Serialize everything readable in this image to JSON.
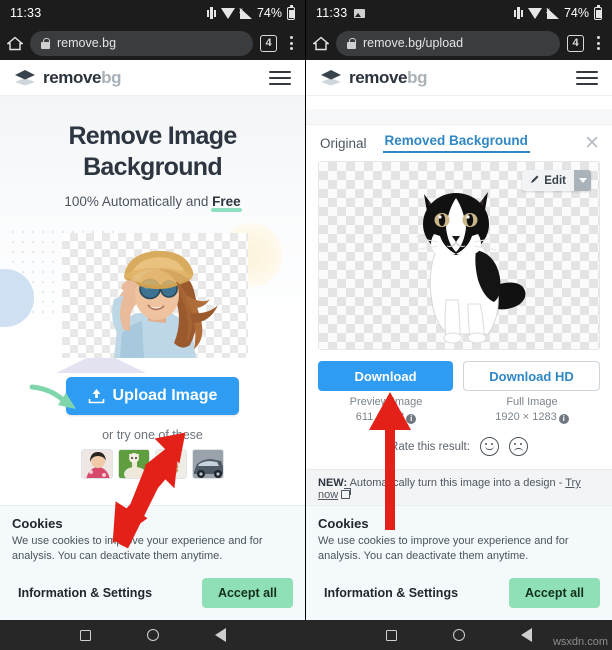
{
  "statusbar": {
    "time": "11:33",
    "battery": "74%",
    "icons": [
      "image-icon",
      "vibrate-icon",
      "wifi-icon",
      "signal-icon",
      "battery-icon"
    ]
  },
  "left_phone": {
    "browser": {
      "home_icon": "home-icon",
      "lock_icon": "lock-icon",
      "url": "remove.bg",
      "tab_count": "4",
      "menu_icon": "kebab-menu-icon"
    },
    "site_header": {
      "logo_primary": "remove",
      "logo_secondary": "bg",
      "menu_icon": "hamburger-menu-icon"
    },
    "hero": {
      "title_line1": "Remove Image",
      "title_line2": "Background",
      "subtitle_prefix": "100% Automatically and ",
      "subtitle_highlight": "Free",
      "upload_button": "Upload Image",
      "upload_icon": "upload-icon",
      "try_text": "or try one of these",
      "thumbnails": [
        "woman-thumbnail",
        "alpaca-thumbnail",
        "product-thumbnail",
        "car-thumbnail"
      ]
    }
  },
  "right_phone": {
    "browser": {
      "home_icon": "home-icon",
      "lock_icon": "lock-icon",
      "url": "remove.bg/upload",
      "tab_count": "4",
      "menu_icon": "kebab-menu-icon"
    },
    "site_header": {
      "logo_primary": "remove",
      "logo_secondary": "bg",
      "menu_icon": "hamburger-menu-icon"
    },
    "result": {
      "tab_original": "Original",
      "tab_removed": "Removed Background",
      "active_tab": "Removed Background",
      "close_icon": "close-icon",
      "edit_button": "Edit",
      "edit_icon": "pencil-icon",
      "edit_caret_icon": "chevron-down-icon",
      "image_subject": "black-and-white-kitten",
      "download_button": "Download",
      "download_hd_button": "Download HD",
      "preview_label": "Preview Image",
      "preview_size": "611 × 408",
      "full_label": "Full Image",
      "full_size": "1920 × 1283",
      "info_icon": "info-icon",
      "rate_label": "Rate this result:",
      "rate_happy_icon": "happy-face-icon",
      "rate_sad_icon": "sad-face-icon",
      "new_badge": "NEW:",
      "new_text": " Automatically turn this image into a design - ",
      "new_link": "Try now",
      "new_link_icon": "external-link-icon"
    }
  },
  "cookies": {
    "title": "Cookies",
    "body": "We use cookies to improve your experience and for analysis. You can deactivate them anytime.",
    "settings_link": "Information & Settings",
    "accept_button": "Accept all"
  },
  "navbar": {
    "recents_icon": "square-recents-icon",
    "home_icon": "circle-home-icon",
    "back_icon": "triangle-back-icon"
  },
  "watermark": "wsxdn.com",
  "colors": {
    "accent_blue": "#2f9cf4",
    "tab_blue": "#2f87c4",
    "accept_green": "#8fe0b6",
    "highlight_green": "#8fe0c0",
    "annotation_red": "#e32119",
    "annotation_green": "#7fd6ab",
    "statusbar_dark": "#1c1c1c"
  }
}
